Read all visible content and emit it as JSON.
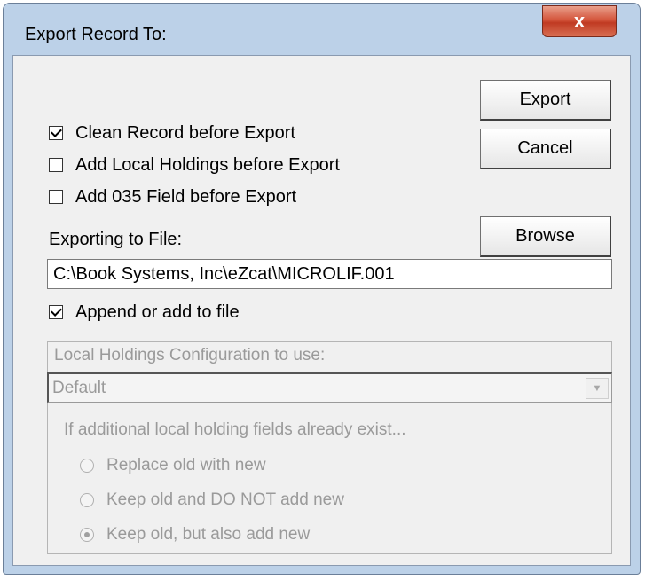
{
  "dialog": {
    "title": "Export Record To:",
    "close_symbol": "x"
  },
  "buttons": {
    "export": "Export",
    "cancel": "Cancel",
    "browse": "Browse"
  },
  "options": [
    {
      "label": "Clean Record before Export",
      "checked": true
    },
    {
      "label": "Add Local Holdings before Export",
      "checked": false
    },
    {
      "label": "Add 035 Field before Export",
      "checked": false
    }
  ],
  "file": {
    "label": "Exporting to File:",
    "path": "C:\\Book Systems, Inc\\eZcat\\MICROLIF.001"
  },
  "append": {
    "label": "Append or add to file",
    "checked": true
  },
  "holdings": {
    "group_title": "Local Holdings Configuration to use:",
    "selected_config": "Default",
    "exist_label": "If additional local holding fields already exist...",
    "radios": [
      {
        "label": "Replace old with new",
        "selected": false
      },
      {
        "label": "Keep old and DO NOT add new",
        "selected": false
      },
      {
        "label": "Keep old, but also add new",
        "selected": true
      }
    ]
  },
  "icons": {
    "close": "close-icon",
    "dropdown": "chevron-down-icon"
  }
}
